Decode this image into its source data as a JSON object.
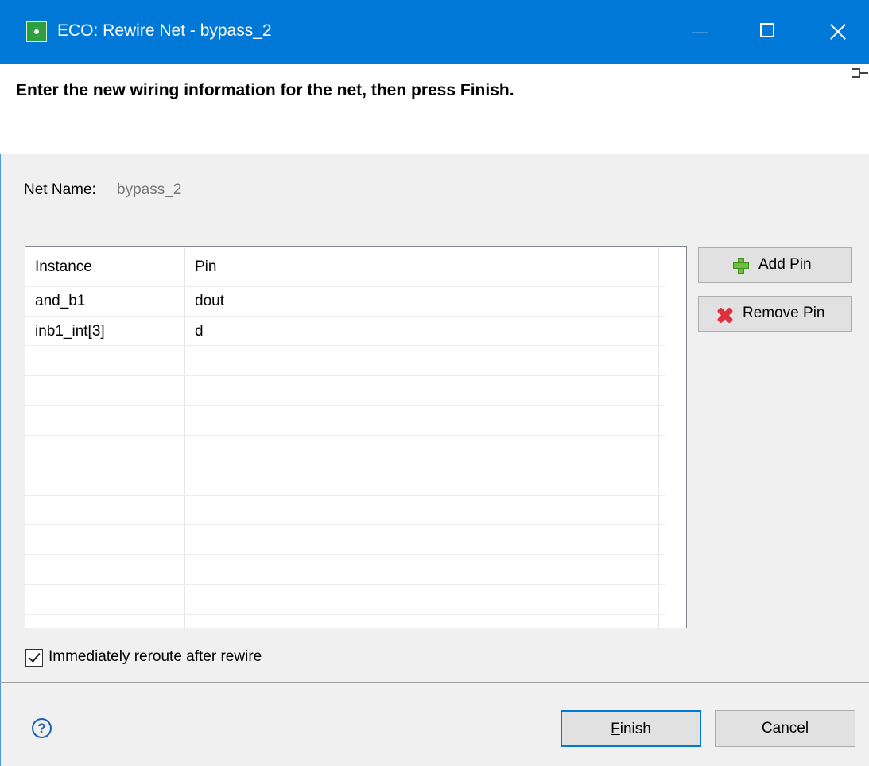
{
  "window": {
    "title": "ECO: Rewire Net - bypass_2"
  },
  "header": {
    "message": "Enter the new wiring information for the net, then press Finish."
  },
  "net": {
    "label": "Net Name:",
    "value": "bypass_2"
  },
  "table": {
    "columns": [
      "Instance",
      "Pin"
    ],
    "rows": [
      {
        "instance": "and_b1",
        "pin": "dout"
      },
      {
        "instance": "inb1_int[3]",
        "pin": "d"
      }
    ]
  },
  "buttons": {
    "add_pin": "Add Pin",
    "remove_pin": "Remove Pin",
    "finish": "Finish",
    "cancel": "Cancel"
  },
  "options": {
    "reroute_label": "Immediately reroute after rewire",
    "reroute_checked": true
  },
  "help": {
    "glyph": "?"
  },
  "colors": {
    "titlebar": "#0078d7",
    "add_icon": "#6fbf3a",
    "remove_icon": "#e0303a",
    "default_button_border": "#0078d7"
  }
}
